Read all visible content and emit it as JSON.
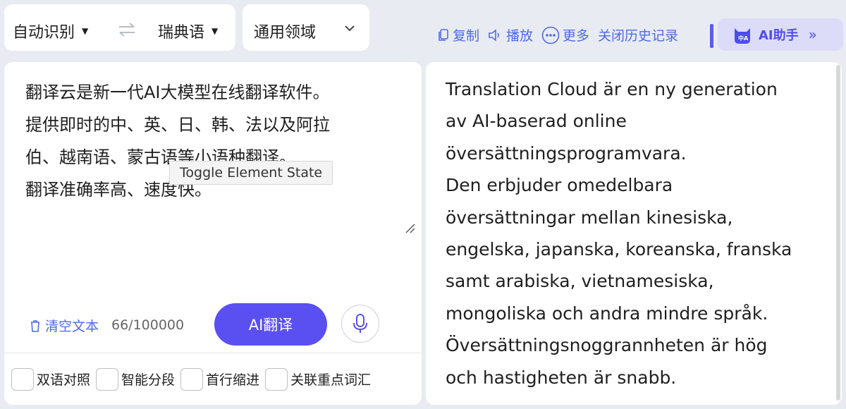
{
  "header": {
    "source_language": "自动识别",
    "target_language": "瑞典语",
    "domain": "通用领域",
    "actions": {
      "copy": "复制",
      "play": "播放",
      "more": "更多",
      "close_history": "关闭历史记录"
    },
    "ai_helper": "AI助手",
    "ai_helper_chevron": "»"
  },
  "source": {
    "text": "翻译云是新一代AI大模型在线翻译软件。\n提供即时的中、英、日、韩、法以及阿拉\n伯、越南语、蒙古语等小语种翻译。\n翻译准确率高、速度快。",
    "tooltip": "Toggle Element State",
    "clear_label": "清空文本",
    "char_count": "66/100000",
    "translate_button": "AI翻译"
  },
  "options": [
    {
      "label": "双语对照",
      "checked": false
    },
    {
      "label": "智能分段",
      "checked": false
    },
    {
      "label": "首行缩进",
      "checked": false
    },
    {
      "label": "关联重点词汇",
      "checked": false
    }
  ],
  "target": {
    "text": "Translation Cloud är en ny generation\nav AI-baserad online\növersättningsprogramvara.\nDen erbjuder omedelbara\növersättningar mellan kinesiska,\nengelska, japanska, koreanska, franska\nsamt arabiska, vietnamesiska,\nmongoliska och andra mindre språk.\nÖversättningsnoggrannheten är hög\noch hastigheten är snabb."
  },
  "colors": {
    "accent": "#5a4ff0",
    "link": "#4d6ae8",
    "background": "#e9ebf2"
  }
}
